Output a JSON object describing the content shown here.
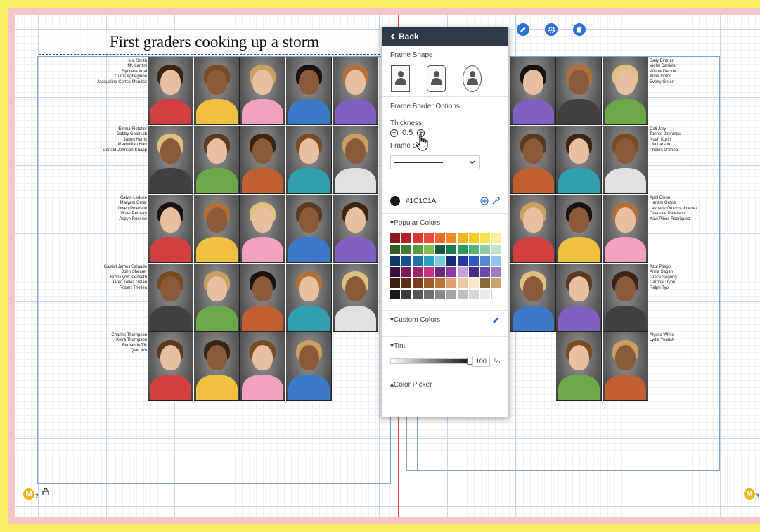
{
  "layout_page": {
    "title": "First graders cooking up a storm",
    "left_page_number": "2",
    "right_page_number": "3",
    "page_marker_letter": "M",
    "name_blocks": {
      "left_row1": [
        "Ms. Smith",
        "Mr. Lentini",
        "Syncere Adai",
        "Curtis Agbeginou",
        "Jacqueline Cortes Mendez"
      ],
      "left_row2": [
        "Emma Fletcher",
        "Gabby Gobirsch",
        "Jason Hams",
        "Maximilian Hart",
        "Donald Johnson-Knapp"
      ],
      "left_row3": [
        "Calvin Leduke",
        "Maryam Omar",
        "Owen Peterson",
        "Violet Petosky",
        "Aspyn Rossow"
      ],
      "left_row4": [
        "Castiel James Salgado",
        "John Shearer",
        "Brooklynn Stenseth",
        "Jared Tellez Galan",
        "Robert Theilen"
      ],
      "left_row5": [
        "Charles Thompson",
        "Keira Thompson",
        "Fernando Tlk",
        "Qian Wu"
      ],
      "right_row1": [
        "Sally Bintner",
        "Violet Daniels",
        "Willow Decker",
        "Alma Golos",
        "Everly Green"
      ],
      "right_row2": [
        "Cali Jary",
        "Tanner Jennings",
        "Noah Kurth",
        "Lila Larson",
        "Phelen O'Shea"
      ],
      "right_row3": [
        "April Olson",
        "Harlem Omoe",
        "Laynerly Orozco-Jimenez",
        "Charlotte Peterson",
        "Xavi Piños Rodriguez"
      ],
      "right_row4": [
        "Azul Pliego",
        "Anna Sagan",
        "Grace Sagong",
        "Carrine Tryon",
        "Ralph Tyo"
      ],
      "right_row5": [
        "Alyssa White",
        "Lydia Yearick"
      ]
    }
  },
  "toolbar_icons": {
    "edit": "pencil-icon",
    "settings": "gear-icon",
    "delete": "trash-icon"
  },
  "panel": {
    "back_label": "Back",
    "frame_shape_title": "Frame Shape",
    "frame_shapes": [
      "square",
      "rounded",
      "oval"
    ],
    "border_options_title": "Frame Border Options",
    "thickness_label": "Thickness",
    "thickness_value": "0.5",
    "frame_style_label": "Frame Style",
    "color_hex": "#1C1C1A",
    "popular_colors_label": "Popular Colors",
    "custom_colors_label": "Custom Colors",
    "tint_label": "Tint",
    "tint_value": "100",
    "tint_unit": "%",
    "tint_level": 1.0,
    "color_picker_label": "Color Picker",
    "palette": [
      "#8b1a1a",
      "#b3222a",
      "#e03a2f",
      "#e84a3c",
      "#ee6a30",
      "#f28a24",
      "#f6b41a",
      "#f8cc26",
      "#f8e24e",
      "#fbf09a",
      "#355e2a",
      "#3f7d34",
      "#5a9a3e",
      "#86b94a",
      "#0f5a3a",
      "#1d7a4c",
      "#2f9a5e",
      "#58b47a",
      "#8ccc9c",
      "#bfe2c6",
      "#0d3a6a",
      "#16508c",
      "#1a74a8",
      "#2aa0c4",
      "#7ccad8",
      "#1a2a7a",
      "#253a9e",
      "#2f5ac4",
      "#5a88d8",
      "#9ac0ec",
      "#3a0f3a",
      "#7a1a5a",
      "#a0226e",
      "#c8338a",
      "#6a2a7a",
      "#8a3aa0",
      "#c8a0e0",
      "#4a2a8a",
      "#6a4aaa",
      "#9a7ac8",
      "#3a1e0e",
      "#5a2e14",
      "#7a3e1c",
      "#9a5a2a",
      "#b8763a",
      "#e0a070",
      "#f0c8a0",
      "#f8e8d0",
      "#8a6a3a",
      "#c8a46a",
      "#1a1a1a",
      "#3a3a3a",
      "#555555",
      "#707070",
      "#8a8a8a",
      "#a5a5a5",
      "#bfbfbf",
      "#d6d6d6",
      "#eaeaea",
      "#ffffff"
    ]
  }
}
